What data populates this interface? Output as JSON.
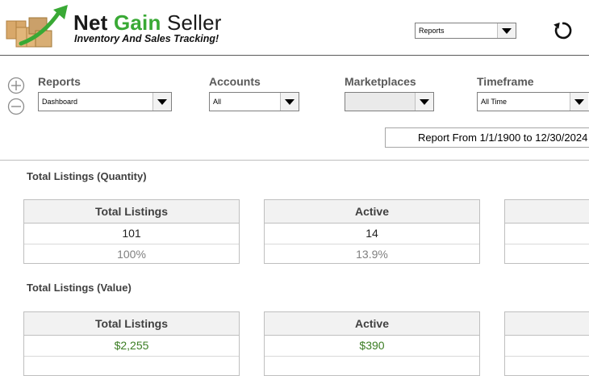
{
  "header": {
    "brand_net": "Net",
    "brand_gain": "Gain",
    "brand_seller": "Seller",
    "tagline": "Inventory And Sales Tracking!",
    "nav_select_value": "Reports",
    "refresh_icon": "refresh-icon"
  },
  "filters": {
    "reports": {
      "label": "Reports",
      "value": "Dashboard"
    },
    "accounts": {
      "label": "Accounts",
      "value": "All"
    },
    "marketplaces": {
      "label": "Marketplaces",
      "value": ""
    },
    "timeframe": {
      "label": "Timeframe",
      "value": "All Time"
    },
    "report_range": "Report From 1/1/1900 to 12/30/2024"
  },
  "sections": {
    "quantity": {
      "title": "Total Listings (Quantity)",
      "cards": [
        {
          "label": "Total Listings",
          "value": "101",
          "percent": "100%"
        },
        {
          "label": "Active",
          "value": "14",
          "percent": "13.9%"
        }
      ]
    },
    "value": {
      "title": "Total Listings (Value)",
      "cards": [
        {
          "label": "Total Listings",
          "value": "$2,255"
        },
        {
          "label": "Active",
          "value": "$390"
        }
      ]
    }
  },
  "colors": {
    "accent_green": "#39a935",
    "value_green": "#3b7d23"
  }
}
